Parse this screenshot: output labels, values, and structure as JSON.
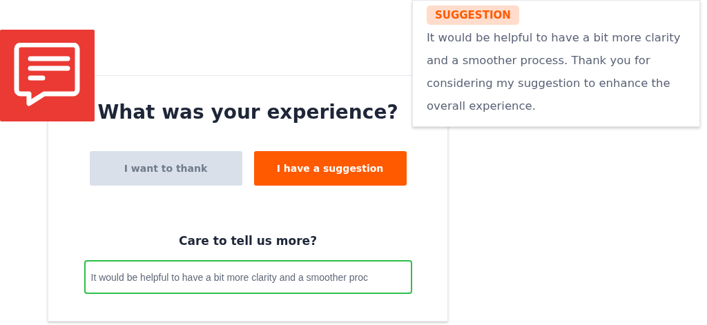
{
  "feedback_card": {
    "title": "What was your experience?",
    "options": [
      {
        "label": "I want to thank",
        "selected": false
      },
      {
        "label": "I have a suggestion",
        "selected": true
      }
    ],
    "prompt": "Care to tell us more?",
    "input": {
      "value": "It would be helpful to have a bit more clarity and a smoother proc",
      "focused": true
    }
  },
  "suggestion_card": {
    "tag": "SUGGESTION",
    "text": "It would be helpful to have a bit more clarity and a smoother process. Thank you for considering my suggestion to enhance the overall experience."
  }
}
